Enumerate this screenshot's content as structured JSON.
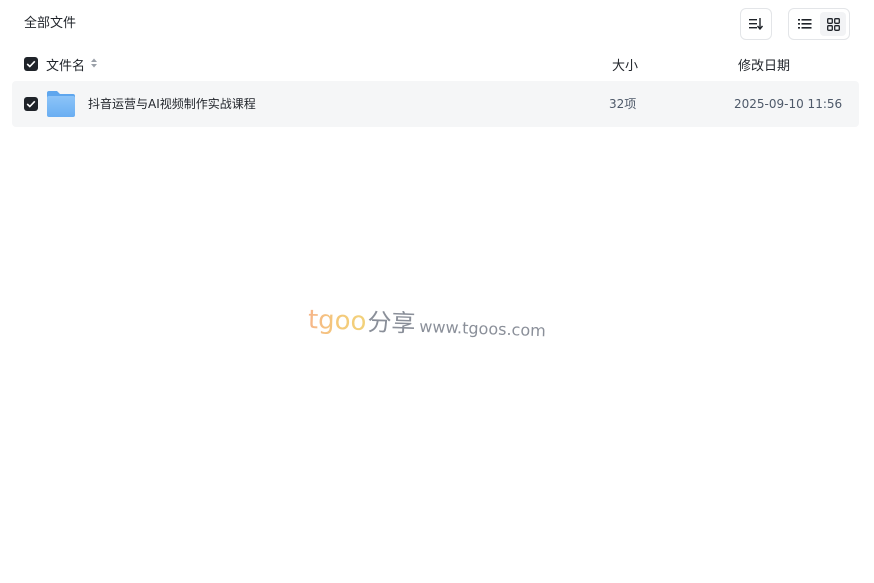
{
  "breadcrumb": {
    "current": "全部文件"
  },
  "toolbar": {
    "sort_icon": "sort-icon",
    "list_view_icon": "list-view-icon",
    "grid_view_icon": "grid-view-icon",
    "active_view": "grid"
  },
  "table": {
    "columns": {
      "name": "文件名",
      "size": "大小",
      "date": "修改日期"
    },
    "select_all_checked": true,
    "rows": [
      {
        "checked": true,
        "icon": "folder-icon",
        "name": "抖音运营与AI视频制作实战课程",
        "size": "32项",
        "date": "2025-09-10 11:56"
      }
    ]
  },
  "watermark": {
    "brand": "tgoo",
    "share": "分享",
    "url": "www.tgoos.com"
  },
  "colors": {
    "row_background": "#f5f6f7",
    "checkbox": "#1f2329",
    "folder": "#7ab8f5"
  }
}
